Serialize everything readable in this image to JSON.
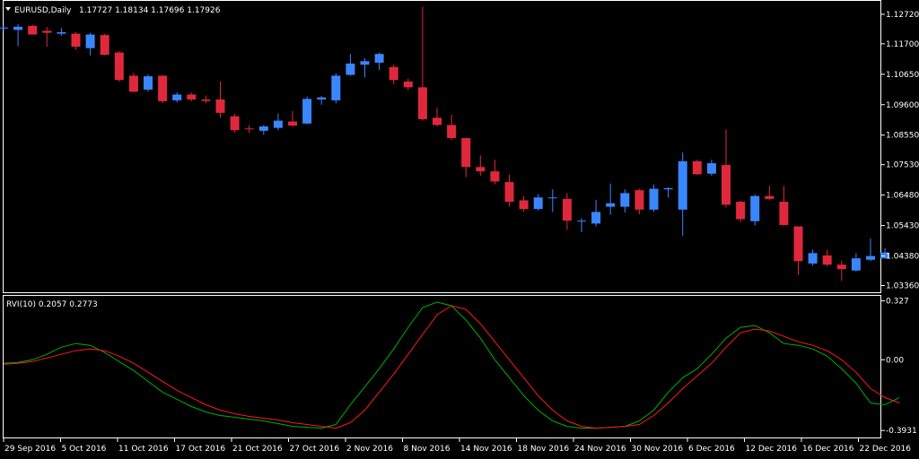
{
  "symbol_label": "EURUSD,Daily",
  "ohlc_readout": "1.17727 1.18134 1.17696 1.17926",
  "indicator_label": "RVI(10) 0.2057 0.2773",
  "colors": {
    "background": "#000000",
    "frame": "#ffffff",
    "bull_candle": "#3a86ff",
    "bear_candle": "#e0283c",
    "rvi_main": "#00b000",
    "rvi_signal": "#ff1a1a",
    "text": "#ffffff"
  },
  "chart_data": [
    {
      "type": "candlestick",
      "title": "EURUSD,Daily",
      "price_ticks": [
        "1.12720",
        "1.11700",
        "1.10650",
        "1.09600",
        "1.08550",
        "1.07530",
        "1.06480",
        "1.05430",
        "1.04380",
        "1.03360"
      ],
      "ylim": [
        1.0316,
        1.1315
      ],
      "date_ticks": [
        "29 Sep 2016",
        "5 Oct 2016",
        "11 Oct 2016",
        "17 Oct 2016",
        "21 Oct 2016",
        "27 Oct 2016",
        "2 Nov 2016",
        "8 Nov 2016",
        "14 Nov 2016",
        "18 Nov 2016",
        "24 Nov 2016",
        "30 Nov 2016",
        "6 Dec 2016",
        "12 Dec 2016",
        "16 Dec 2016",
        "22 Dec 2016"
      ],
      "candles": [
        {
          "o": 1.1223,
          "h": 1.1235,
          "l": 1.1212,
          "c": 1.1226
        },
        {
          "o": 1.1218,
          "h": 1.1238,
          "l": 1.1162,
          "c": 1.1229
        },
        {
          "o": 1.1232,
          "h": 1.1236,
          "l": 1.1208,
          "c": 1.1202
        },
        {
          "o": 1.1215,
          "h": 1.1228,
          "l": 1.116,
          "c": 1.1208
        },
        {
          "o": 1.1205,
          "h": 1.1225,
          "l": 1.1198,
          "c": 1.121
        },
        {
          "o": 1.1205,
          "h": 1.121,
          "l": 1.115,
          "c": 1.116
        },
        {
          "o": 1.1155,
          "h": 1.1208,
          "l": 1.113,
          "c": 1.1202
        },
        {
          "o": 1.12,
          "h": 1.1205,
          "l": 1.113,
          "c": 1.1132
        },
        {
          "o": 1.114,
          "h": 1.1145,
          "l": 1.104,
          "c": 1.1045
        },
        {
          "o": 1.106,
          "h": 1.107,
          "l": 1.1003,
          "c": 1.1005
        },
        {
          "o": 1.1012,
          "h": 1.1065,
          "l": 1.1005,
          "c": 1.1058
        },
        {
          "o": 1.106,
          "h": 1.1062,
          "l": 1.0965,
          "c": 1.0972
        },
        {
          "o": 1.0975,
          "h": 1.1003,
          "l": 1.0968,
          "c": 1.0995
        },
        {
          "o": 1.0995,
          "h": 1.1002,
          "l": 1.0972,
          "c": 1.0978
        },
        {
          "o": 1.0978,
          "h": 1.0992,
          "l": 1.0965,
          "c": 1.0973
        },
        {
          "o": 1.0978,
          "h": 1.104,
          "l": 1.0915,
          "c": 1.0932
        },
        {
          "o": 1.092,
          "h": 1.0928,
          "l": 1.0864,
          "c": 1.0872
        },
        {
          "o": 1.0878,
          "h": 1.089,
          "l": 1.0862,
          "c": 1.0876
        },
        {
          "o": 1.087,
          "h": 1.089,
          "l": 1.0856,
          "c": 1.0885
        },
        {
          "o": 1.088,
          "h": 1.093,
          "l": 1.0872,
          "c": 1.0905
        },
        {
          "o": 1.0902,
          "h": 1.0938,
          "l": 1.0885,
          "c": 1.0888
        },
        {
          "o": 1.0895,
          "h": 1.0988,
          "l": 1.0892,
          "c": 1.098
        },
        {
          "o": 1.0978,
          "h": 1.099,
          "l": 1.096,
          "c": 1.0985
        },
        {
          "o": 1.0975,
          "h": 1.1068,
          "l": 1.0965,
          "c": 1.106
        },
        {
          "o": 1.1063,
          "h": 1.1135,
          "l": 1.106,
          "c": 1.1102
        },
        {
          "o": 1.1098,
          "h": 1.112,
          "l": 1.1055,
          "c": 1.111
        },
        {
          "o": 1.1105,
          "h": 1.114,
          "l": 1.108,
          "c": 1.1135
        },
        {
          "o": 1.109,
          "h": 1.1098,
          "l": 1.103,
          "c": 1.1045
        },
        {
          "o": 1.104,
          "h": 1.105,
          "l": 1.101,
          "c": 1.102
        },
        {
          "o": 1.102,
          "h": 1.1298,
          "l": 1.0905,
          "c": 1.091
        },
        {
          "o": 1.0915,
          "h": 1.095,
          "l": 1.0885,
          "c": 1.089
        },
        {
          "o": 1.089,
          "h": 1.0925,
          "l": 1.0838,
          "c": 1.0845
        },
        {
          "o": 1.0845,
          "h": 1.0845,
          "l": 1.071,
          "c": 1.0745
        },
        {
          "o": 1.0745,
          "h": 1.0785,
          "l": 1.0715,
          "c": 1.073
        },
        {
          "o": 1.073,
          "h": 1.077,
          "l": 1.0685,
          "c": 1.0695
        },
        {
          "o": 1.0693,
          "h": 1.0718,
          "l": 1.0608,
          "c": 1.0625
        },
        {
          "o": 1.063,
          "h": 1.0645,
          "l": 1.059,
          "c": 1.06
        },
        {
          "o": 1.06,
          "h": 1.0652,
          "l": 1.0595,
          "c": 1.064
        },
        {
          "o": 1.0638,
          "h": 1.0668,
          "l": 1.059,
          "c": 1.064
        },
        {
          "o": 1.0635,
          "h": 1.0655,
          "l": 1.0528,
          "c": 1.056
        },
        {
          "o": 1.056,
          "h": 1.0568,
          "l": 1.052,
          "c": 1.056
        },
        {
          "o": 1.055,
          "h": 1.0632,
          "l": 1.054,
          "c": 1.059
        },
        {
          "o": 1.0608,
          "h": 1.0688,
          "l": 1.058,
          "c": 1.062
        },
        {
          "o": 1.0608,
          "h": 1.0668,
          "l": 1.0588,
          "c": 1.0655
        },
        {
          "o": 1.0665,
          "h": 1.067,
          "l": 1.0582,
          "c": 1.0598
        },
        {
          "o": 1.0598,
          "h": 1.0685,
          "l": 1.059,
          "c": 1.067
        },
        {
          "o": 1.0668,
          "h": 1.0675,
          "l": 1.064,
          "c": 1.0672
        },
        {
          "o": 1.0598,
          "h": 1.0795,
          "l": 1.0508,
          "c": 1.0765
        },
        {
          "o": 1.0765,
          "h": 1.077,
          "l": 1.0718,
          "c": 1.072
        },
        {
          "o": 1.0722,
          "h": 1.077,
          "l": 1.0715,
          "c": 1.0758
        },
        {
          "o": 1.0752,
          "h": 1.0875,
          "l": 1.0605,
          "c": 1.0615
        },
        {
          "o": 1.0625,
          "h": 1.0628,
          "l": 1.0555,
          "c": 1.0565
        },
        {
          "o": 1.0558,
          "h": 1.065,
          "l": 1.0543,
          "c": 1.0645
        },
        {
          "o": 1.0645,
          "h": 1.068,
          "l": 1.063,
          "c": 1.0635
        },
        {
          "o": 1.0625,
          "h": 1.068,
          "l": 1.0542,
          "c": 1.0545
        },
        {
          "o": 1.054,
          "h": 1.054,
          "l": 1.0372,
          "c": 1.042
        },
        {
          "o": 1.0412,
          "h": 1.046,
          "l": 1.0405,
          "c": 1.0448
        },
        {
          "o": 1.044,
          "h": 1.046,
          "l": 1.0402,
          "c": 1.0408
        },
        {
          "o": 1.0408,
          "h": 1.0422,
          "l": 1.0352,
          "c": 1.0393
        },
        {
          "o": 1.0388,
          "h": 1.0448,
          "l": 1.0385,
          "c": 1.043
        },
        {
          "o": 1.0425,
          "h": 1.0498,
          "l": 1.042,
          "c": 1.0438
        },
        {
          "o": 1.043,
          "h": 1.0465,
          "l": 1.0428,
          "c": 1.045
        }
      ]
    },
    {
      "type": "line",
      "title": "RVI(10) 0.2057 0.2773",
      "y_ticks": [
        "0.327",
        "0.00",
        "-0.3931"
      ],
      "ylim": [
        -0.427,
        0.35
      ],
      "series": [
        {
          "values": [
            -0.02,
            -0.015,
            0.0,
            0.03,
            0.07,
            0.09,
            0.08,
            0.04,
            -0.01,
            -0.06,
            -0.12,
            -0.18,
            -0.22,
            -0.26,
            -0.29,
            -0.31,
            -0.32,
            -0.33,
            -0.34,
            -0.355,
            -0.37,
            -0.375,
            -0.38,
            -0.36,
            -0.25,
            -0.15,
            -0.05,
            0.06,
            0.18,
            0.29,
            0.32,
            0.3,
            0.22,
            0.12,
            0.0,
            -0.1,
            -0.2,
            -0.28,
            -0.34,
            -0.37,
            -0.38,
            -0.38,
            -0.375,
            -0.37,
            -0.34,
            -0.28,
            -0.18,
            -0.1,
            -0.05,
            0.03,
            0.12,
            0.18,
            0.19,
            0.15,
            0.09,
            0.08,
            0.06,
            0.02,
            -0.05,
            -0.13,
            -0.24,
            -0.25,
            -0.21
          ]
        },
        {
          "values": [
            -0.025,
            -0.02,
            -0.01,
            0.01,
            0.03,
            0.05,
            0.06,
            0.05,
            0.02,
            -0.02,
            -0.07,
            -0.12,
            -0.17,
            -0.21,
            -0.25,
            -0.28,
            -0.3,
            -0.315,
            -0.325,
            -0.335,
            -0.35,
            -0.36,
            -0.37,
            -0.38,
            -0.35,
            -0.28,
            -0.18,
            -0.08,
            0.03,
            0.14,
            0.25,
            0.3,
            0.28,
            0.2,
            0.1,
            0.0,
            -0.1,
            -0.2,
            -0.28,
            -0.34,
            -0.37,
            -0.38,
            -0.375,
            -0.37,
            -0.36,
            -0.31,
            -0.24,
            -0.16,
            -0.09,
            -0.02,
            0.07,
            0.15,
            0.17,
            0.16,
            0.13,
            0.1,
            0.08,
            0.05,
            0.0,
            -0.07,
            -0.16,
            -0.21,
            -0.24
          ]
        }
      ]
    }
  ]
}
